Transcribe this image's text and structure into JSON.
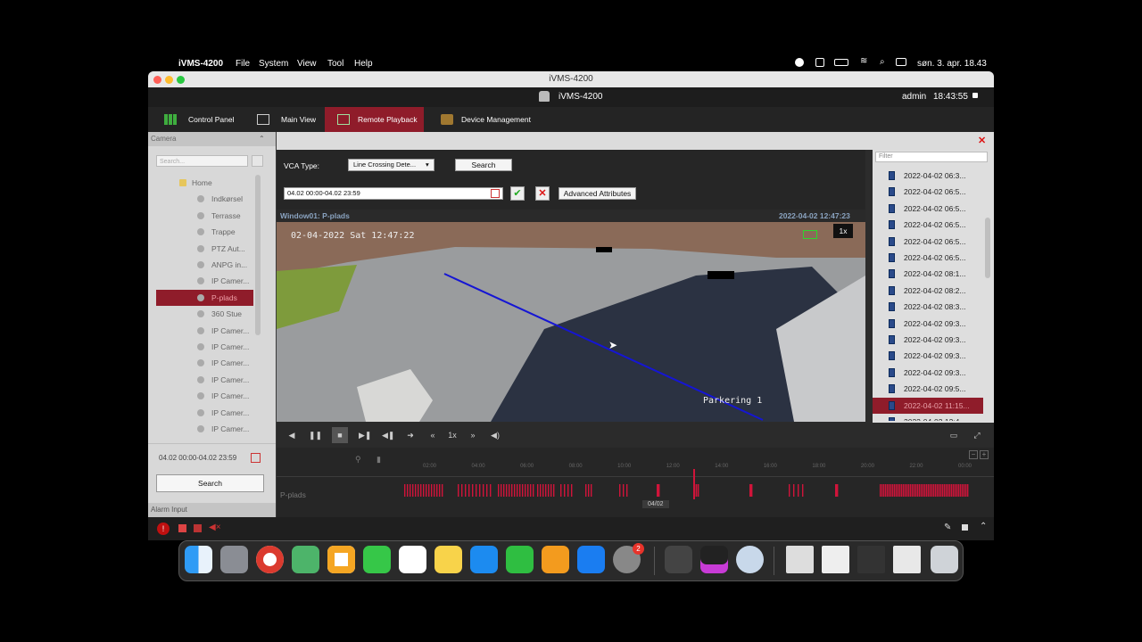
{
  "menubar": {
    "app_name": "iVMS-4200",
    "menus": [
      "File",
      "System",
      "View",
      "Tool",
      "Help"
    ],
    "clock": "søn. 3. apr. 18.43"
  },
  "window": {
    "title": "iVMS-4200",
    "app_title": "iVMS-4200",
    "user": "admin",
    "time": "18:43:55"
  },
  "nav": {
    "tabs": [
      {
        "label": "Control Panel"
      },
      {
        "label": "Main View"
      },
      {
        "label": "Remote Playback"
      },
      {
        "label": "Device Management"
      }
    ]
  },
  "sidebar": {
    "camera_header": "Camera",
    "search_placeholder": "Search...",
    "tree": [
      {
        "label": "Home"
      },
      {
        "label": "Indkørsel"
      },
      {
        "label": "Terrasse"
      },
      {
        "label": "Trappe"
      },
      {
        "label": "PTZ Aut..."
      },
      {
        "label": "ANPG in..."
      },
      {
        "label": "IP Camer..."
      },
      {
        "label": "P-plads"
      },
      {
        "label": "360 Stue"
      },
      {
        "label": "IP Camer..."
      },
      {
        "label": "IP Camer..."
      },
      {
        "label": "IP Camer..."
      },
      {
        "label": "IP Camer..."
      },
      {
        "label": "IP Camer..."
      },
      {
        "label": "IP Camer..."
      },
      {
        "label": "IP Camer..."
      }
    ],
    "date_range": "04.02 00:00-04.02 23:59",
    "search_button": "Search",
    "alarm_input": "Alarm Input"
  },
  "filter": {
    "vca_label": "VCA Type:",
    "vca_value": "Line Crossing Dete...",
    "search_button": "Search",
    "date_range": "04.02 00:00-04.02 23:59",
    "advanced_button": "Advanced Attributes"
  },
  "video": {
    "window_label": "Window01:  P-plads",
    "timestamp": "2022-04-02 12:47:23",
    "osd_date": "02-04-2022 Sat 12:47:22",
    "osd_name": "Parkering 1",
    "speed": "1x"
  },
  "results": {
    "filter_placeholder": "Filter",
    "items": [
      "2022-04-02 06:3...",
      "2022-04-02 06:5...",
      "2022-04-02 06:5...",
      "2022-04-02 06:5...",
      "2022-04-02 06:5...",
      "2022-04-02 06:5...",
      "2022-04-02 08:1...",
      "2022-04-02 08:2...",
      "2022-04-02 08:3...",
      "2022-04-02 09:3...",
      "2022-04-02 09:3...",
      "2022-04-02 09:3...",
      "2022-04-02 09:3...",
      "2022-04-02 09:5...",
      "2022-04-02 11:15...",
      "2022-04-02 12:4..."
    ],
    "selected_index": 14
  },
  "controls": {
    "speed": "1x"
  },
  "timeline": {
    "ticks": [
      "02:00",
      "04:00",
      "06:00",
      "08:00",
      "10:00",
      "12:00",
      "14:00",
      "16:00",
      "18:00",
      "20:00",
      "22:00",
      "00:00"
    ],
    "channel": "P-plads",
    "date_tag": "04/02"
  },
  "dock": {
    "badge": "2"
  },
  "colors": {
    "accent": "#8f1c2a",
    "record": "#d0143a",
    "chrome": "#1d1d1d"
  }
}
